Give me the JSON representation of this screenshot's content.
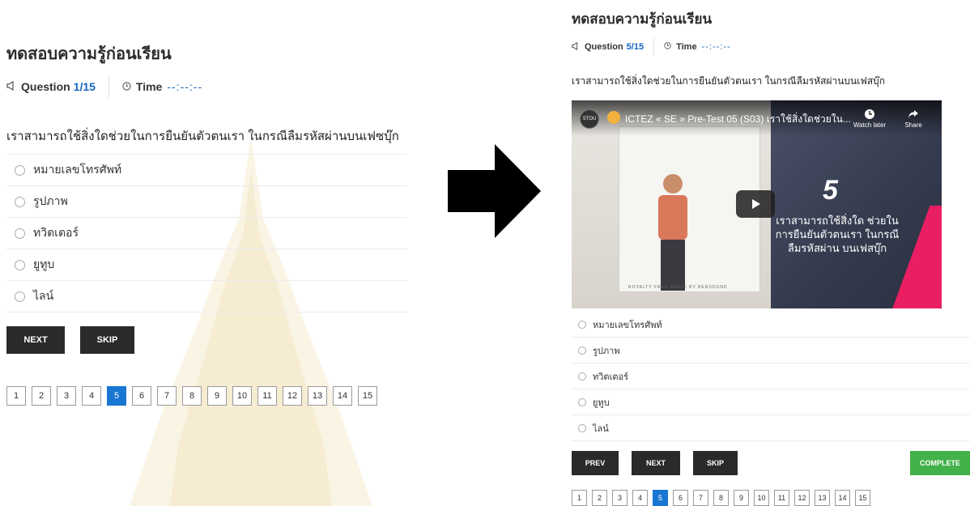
{
  "left_quiz": {
    "title": "ทดสอบความรู้ก่อนเรียน",
    "question_label": "Question",
    "question_progress": "1/15",
    "time_label": "Time",
    "time_value": "--:--:--",
    "question_text": "เราสามารถใช้สิ่งใดช่วยในการยืนยันตัวตนเรา ในกรณีลืมรหัสผ่านบนเฟซบุ๊ก",
    "options": [
      "หมายเลขโทรศัพท์",
      "รูปภาพ",
      "ทวิตเตอร์",
      "ยูทูบ",
      "ไลน์"
    ],
    "buttons": {
      "next": "NEXT",
      "skip": "SKIP"
    },
    "pages": [
      "1",
      "2",
      "3",
      "4",
      "5",
      "6",
      "7",
      "8",
      "9",
      "10",
      "11",
      "12",
      "13",
      "14",
      "15"
    ],
    "active_page": "5"
  },
  "right_quiz": {
    "title": "ทดสอบความรู้ก่อนเรียน",
    "question_label": "Question",
    "question_progress": "5/15",
    "time_label": "Time",
    "time_value": "--:--:--",
    "question_text": "เราสามารถใช้สิ่งใดช่วยในการยืนยันตัวตนเรา ในกรณีลืมรหัสผ่านบนเฟสบุ๊ก",
    "video": {
      "channel_logo": "STOU",
      "title": "ICTEZ « SE » Pre-Test 05 (S03) เราใช้สิ่งใดช่วยใน...",
      "watch_later": "Watch later",
      "share": "Share",
      "slide_number": "5",
      "slide_text": "เราสามารถใช้สิ่งใด ช่วยในการยืนยันตัวตนเรา ในกรณีลืมรหัสผ่าน บนเฟสบุ๊ก",
      "credit": "ROYALTY FREE MUSIC BY BENSOUND"
    },
    "options": [
      "หมายเลขโทรศัพท์",
      "รูปภาพ",
      "ทวิตเตอร์",
      "ยูทูบ",
      "ไลน์"
    ],
    "buttons": {
      "prev": "PREV",
      "next": "NEXT",
      "skip": "SKIP",
      "complete": "COMPLETE"
    },
    "pages": [
      "1",
      "2",
      "3",
      "4",
      "5",
      "6",
      "7",
      "8",
      "9",
      "10",
      "11",
      "12",
      "13",
      "14",
      "15"
    ],
    "active_page": "5"
  },
  "colors": {
    "accent": "#1976d2",
    "button_dark": "#2a2a2a",
    "complete_green": "#43b14a"
  },
  "icons": {
    "question": "megaphone-icon",
    "time": "clock-icon",
    "transition": "right-arrow-icon"
  }
}
